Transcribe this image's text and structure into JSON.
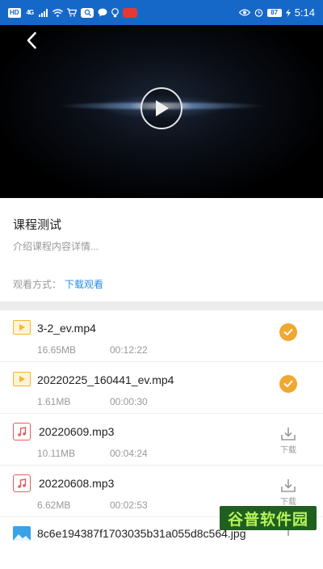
{
  "status_bar": {
    "hd": "HD",
    "signal": "4G",
    "battery": "87",
    "time": "5:14"
  },
  "course": {
    "title": "课程测试",
    "description": "介绍课程内容详情...",
    "watch_label": "观看方式：",
    "watch_mode": "下载观看"
  },
  "files": [
    {
      "name": "3-2_ev.mp4",
      "size": "16.65MB",
      "duration": "00:12:22",
      "type": "video",
      "downloaded": true
    },
    {
      "name": "20220225_160441_ev.mp4",
      "size": "1.61MB",
      "duration": "00:00:30",
      "type": "video",
      "downloaded": true
    },
    {
      "name": "20220609.mp3",
      "size": "10.11MB",
      "duration": "00:04:24",
      "type": "audio",
      "downloaded": false
    },
    {
      "name": "20220608.mp3",
      "size": "6.62MB",
      "duration": "00:02:53",
      "type": "audio",
      "downloaded": false
    },
    {
      "name": "8c6e194387f1703035b31a055d8c564.jpg",
      "type": "image"
    }
  ],
  "download_label": "下载",
  "watermark": "谷普软件园",
  "colors": {
    "status_bar": "#1668c8",
    "accent_blue": "#2b8be6",
    "done_orange": "#f0a830",
    "video_icon": "#f2b632",
    "audio_icon": "#e85b5b",
    "image_icon": "#3aa3e8"
  },
  "icons": {
    "back": "chevron-left-icon",
    "play": "play-icon",
    "done": "check-circle-icon",
    "download": "download-icon"
  }
}
